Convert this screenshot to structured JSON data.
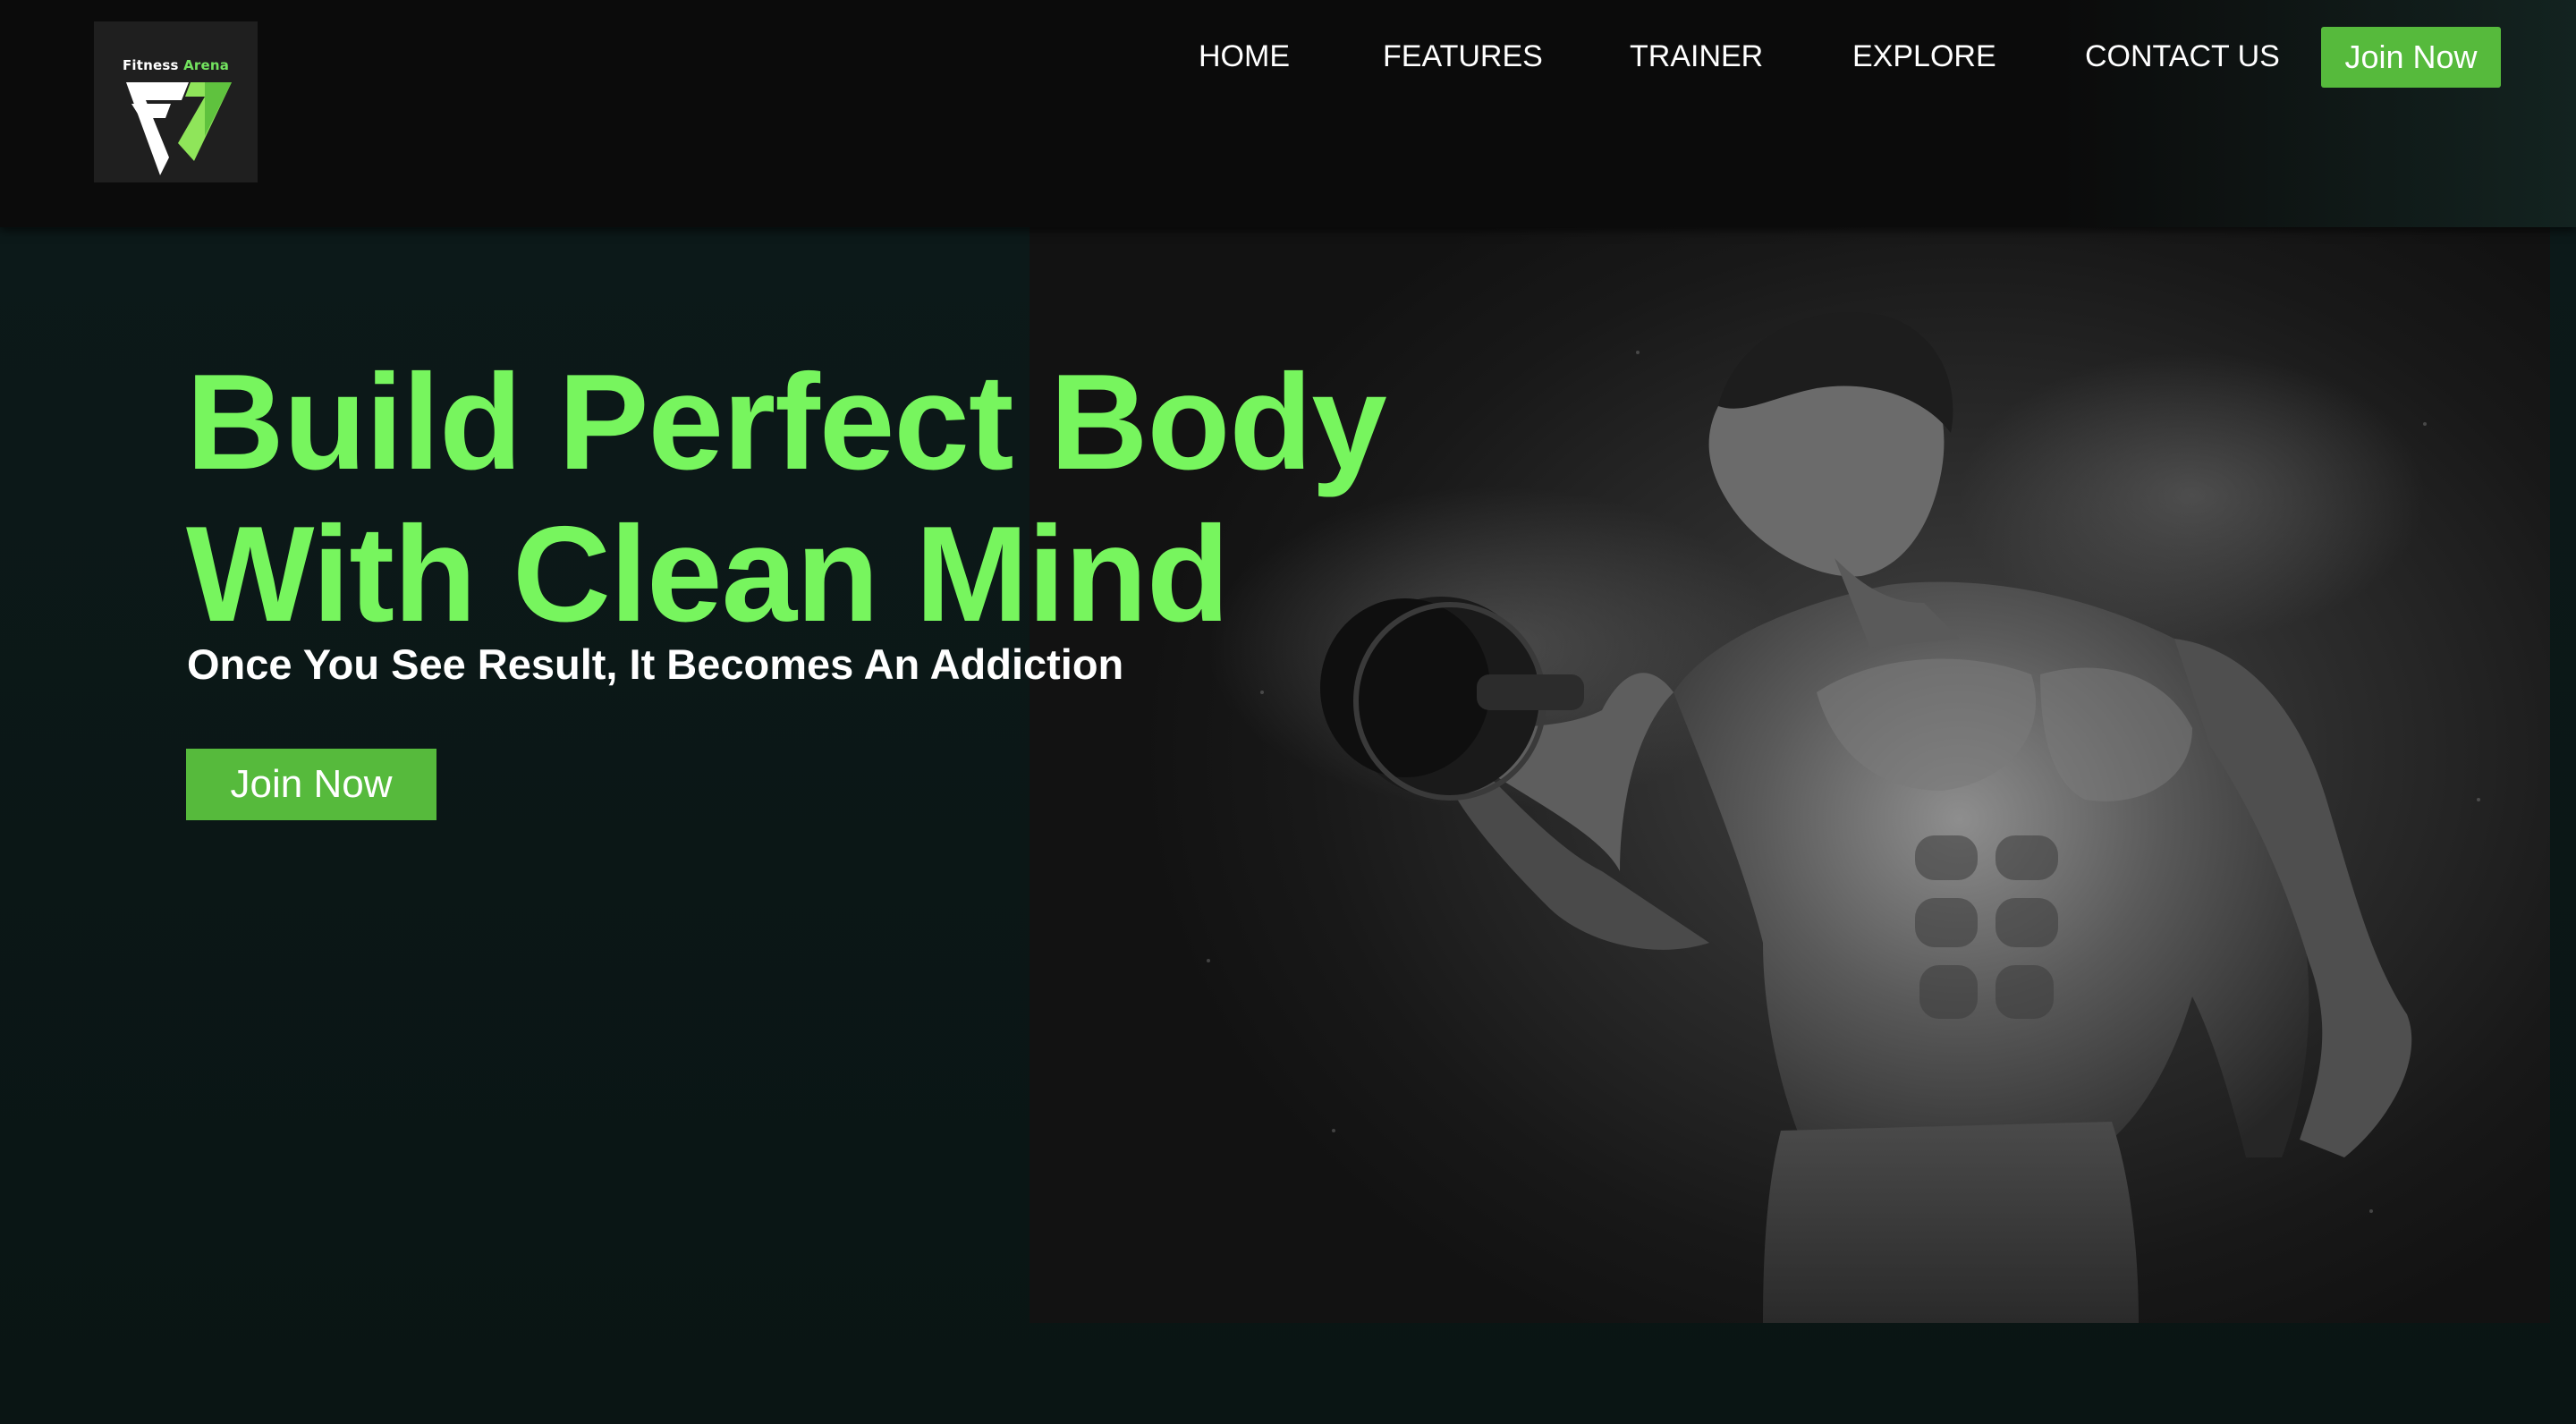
{
  "brand": {
    "logo_word1": "Fitness",
    "logo_word2": "Arena",
    "logo_icon": "fa-monogram-icon"
  },
  "nav": {
    "items": [
      {
        "label": "HOME"
      },
      {
        "label": "FEATURES"
      },
      {
        "label": "TRAINER"
      },
      {
        "label": "EXPLORE"
      },
      {
        "label": "CONTACT US"
      }
    ],
    "cta_label": "Join Now"
  },
  "hero": {
    "headline_line1": "Build Perfect Body",
    "headline_line2": "With Clean Mind",
    "tagline": "Once You See Result, It Becomes An Addiction",
    "cta_label": "Join Now",
    "image": "bodybuilder-dumbbell-photo"
  },
  "colors": {
    "accent_green": "#77f55e",
    "button_green": "#56ba3c",
    "header_bg": "#0b0b0b",
    "hero_bg": "#0c1919"
  }
}
